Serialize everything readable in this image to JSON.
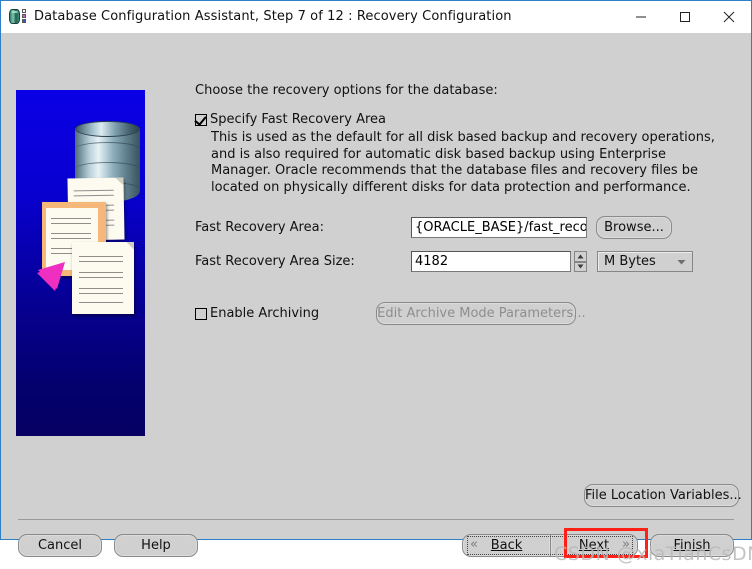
{
  "window": {
    "title": "Database Configuration Assistant, Step 7 of 12 : Recovery Configuration",
    "icon": "oracle-dbca-icon",
    "controls": {
      "minimize": "minimize-icon",
      "maximize": "maximize-icon",
      "close": "close-icon"
    }
  },
  "illustration": {
    "name": "recovery-illustration",
    "background_top": "#0a00e6",
    "background_bottom": "#050061",
    "arrow_color": "#ef2fc0",
    "cylinder": "database-cylinder-icon",
    "documents": "document-sheets-icon"
  },
  "main": {
    "prompt": "Choose the recovery options for the database:",
    "specify_fra": {
      "label": "Specify Fast Recovery Area",
      "checked": true,
      "description": "This is used as the default for all disk based backup and recovery operations, and is also required for automatic disk based backup using Enterprise Manager. Oracle recommends that the database files and recovery files be located on physically different disks for data protection and performance."
    },
    "fields": {
      "fra_label": "Fast Recovery Area:",
      "fra_value": "{ORACLE_BASE}/fast_recovery_a",
      "browse_label": "Browse...",
      "size_label": "Fast Recovery Area Size:",
      "size_value": "4182",
      "unit_value": "M Bytes"
    },
    "enable_archiving": {
      "label": "Enable Archiving",
      "checked": false,
      "edit_button": "Edit Archive Mode Parameters...",
      "edit_button_disabled": true
    },
    "file_location_variables": "File Location Variables..."
  },
  "footer": {
    "cancel": "Cancel",
    "help": "Help",
    "back": "Back",
    "next": "Next",
    "finish": "Finish",
    "highlight_color": "#ff2016"
  },
  "watermark": {
    "text": "CSDN @xiaTianCsDM"
  }
}
